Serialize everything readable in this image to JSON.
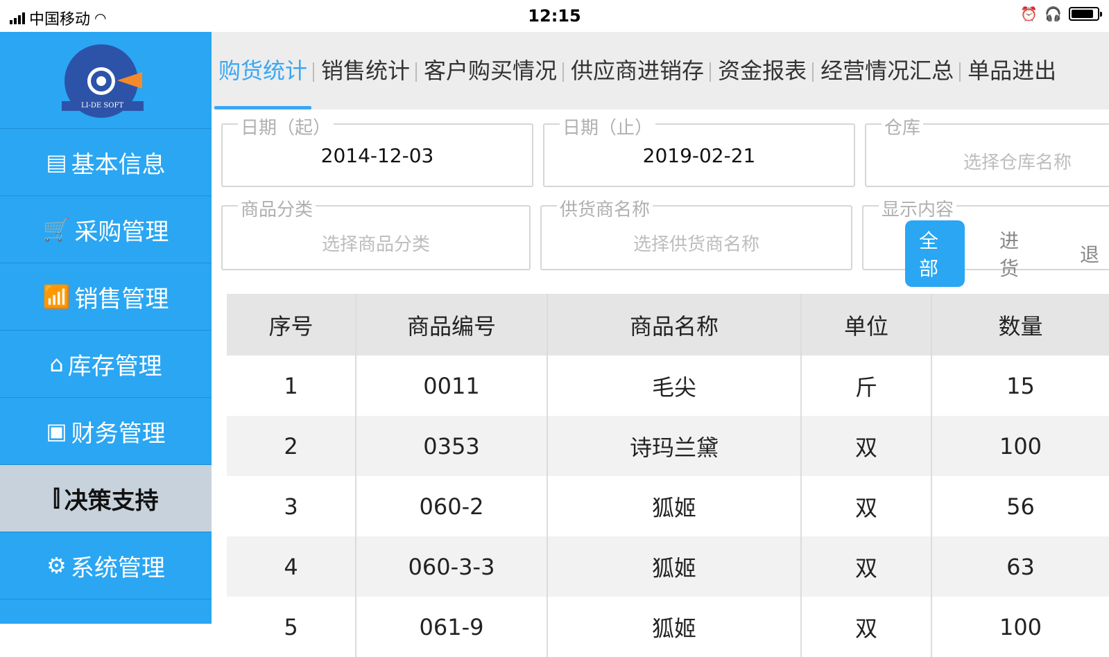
{
  "status_bar": {
    "carrier": "中国移动",
    "time": "12:15",
    "battery_level": 0.9
  },
  "sidebar": {
    "logo_text": "LI-DE SOFT",
    "items": [
      {
        "label": "基本信息",
        "icon": "document-icon"
      },
      {
        "label": "采购管理",
        "icon": "cart-icon"
      },
      {
        "label": "销售管理",
        "icon": "chart-icon"
      },
      {
        "label": "库存管理",
        "icon": "warehouse-icon"
      },
      {
        "label": "财务管理",
        "icon": "wallet-icon"
      },
      {
        "label": "决策支持",
        "icon": "sliders-icon"
      },
      {
        "label": "系统管理",
        "icon": "gear-icon"
      }
    ],
    "active_index": 5
  },
  "tabs": [
    "购货统计",
    "销售统计",
    "客户购买情况",
    "供应商进销存",
    "资金报表",
    "经营情况汇总",
    "单品进出"
  ],
  "filters": {
    "date_start": {
      "label": "日期（起）",
      "value": "2014-12-03"
    },
    "date_end": {
      "label": "日期（止）",
      "value": "2019-02-21"
    },
    "warehouse": {
      "label": "仓库",
      "placeholder": "选择仓库名称"
    },
    "category": {
      "label": "商品分类",
      "placeholder": "选择商品分类"
    },
    "supplier": {
      "label": "供货商名称",
      "placeholder": "选择供货商名称"
    },
    "display": {
      "label": "显示内容",
      "options": [
        "全部",
        "进货",
        "退"
      ],
      "selected": 0
    }
  },
  "table": {
    "headers": [
      "序号",
      "商品编号",
      "商品名称",
      "单位",
      "数量"
    ],
    "rows": [
      [
        "1",
        "0011",
        "毛尖",
        "斤",
        "15"
      ],
      [
        "2",
        "0353",
        "诗玛兰黛",
        "双",
        "100"
      ],
      [
        "3",
        "060-2",
        "狐姬",
        "双",
        "56"
      ],
      [
        "4",
        "060-3-3",
        "狐姬",
        "双",
        "63"
      ],
      [
        "5",
        "061-9",
        "狐姬",
        "双",
        "100"
      ]
    ]
  }
}
